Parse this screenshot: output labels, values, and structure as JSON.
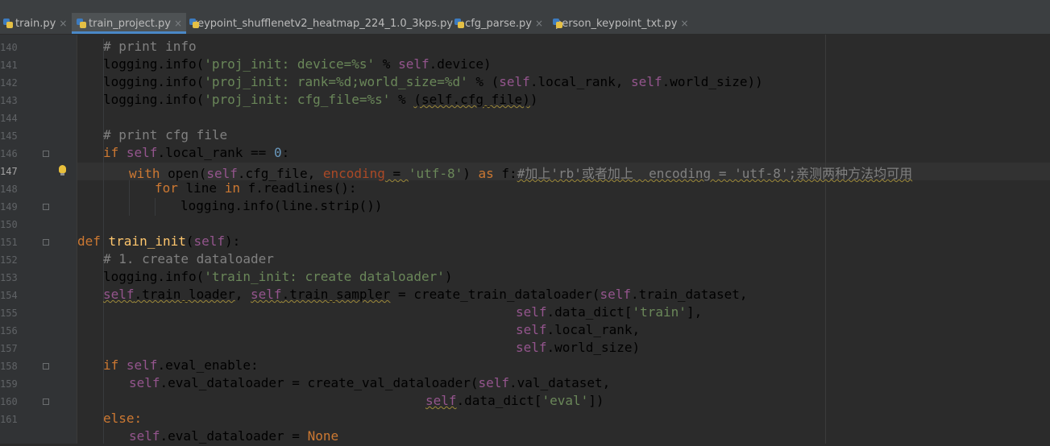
{
  "tabs": [
    {
      "label": "train.py",
      "active": false
    },
    {
      "label": "train_project.py",
      "active": true
    },
    {
      "label": "keypoint_shufflenetv2_heatmap_224_1.0_3kps.py",
      "active": false
    },
    {
      "label": "cfg_parse.py",
      "active": false
    },
    {
      "label": "person_keypoint_txt.py",
      "active": false
    }
  ],
  "gutter": {
    "line_numbers": [
      "140",
      "141",
      "142",
      "143",
      "144",
      "145",
      "146",
      "147",
      "148",
      "149",
      "150",
      "151",
      "152",
      "153",
      "154",
      "155",
      "156",
      "157",
      "158",
      "159",
      "160",
      "161"
    ]
  },
  "code": {
    "l140": {
      "a": "# print info"
    },
    "l141": {
      "a": "logging.info(",
      "b": "'proj_init: device=%s'",
      "c": " % ",
      "d": "self",
      "e": ".device)"
    },
    "l142": {
      "a": "logging.info(",
      "b": "'proj_init: rank=%d;world_size=%d'",
      "c": " % (",
      "d": "self",
      "e": ".local_rank, ",
      "f": "self",
      "g": ".world_size))"
    },
    "l143": {
      "a": "logging.info(",
      "b": "'proj_init: cfg_file=%s'",
      "c": " % ",
      "d": "(self.cfg_file)",
      "e": ")"
    },
    "l145": {
      "a": "# print cfg file"
    },
    "l146": {
      "a": "if ",
      "b": "self",
      "c": ".local_rank == ",
      "d": "0",
      "e": ":"
    },
    "l147": {
      "a": "with ",
      "b": "open(",
      "c": "self",
      "d": ".cfg_file, ",
      "e": "encoding",
      "f": " = ",
      "g": "'utf-8'",
      "h": ") ",
      "i": "as ",
      "j": "f:",
      "k": "#加上'rb'或者加上  encoding = 'utf-8';亲测两种方法均可用"
    },
    "l148": {
      "a": "for ",
      "b": "line ",
      "c": "in ",
      "d": "f.readlines():"
    },
    "l149": {
      "a": "logging.info(line.strip())"
    },
    "l151": {
      "a": "def ",
      "b": "train_init",
      "c": "(",
      "d": "self",
      "e": "):"
    },
    "l152": {
      "a": "# 1. create dataloader"
    },
    "l153": {
      "a": "logging.info(",
      "b": "'train_init: create dataloader'",
      "c": ")"
    },
    "l154": {
      "a": "self",
      "b": ".train_loader",
      "c": ", ",
      "d": "self",
      "e": ".train_sampler",
      "f": " = create_train_dataloader(",
      "g": "self",
      "h": ".train_dataset,"
    },
    "l155": {
      "a": "self",
      "b": ".data_dict[",
      "c": "'train'",
      "d": "],"
    },
    "l156": {
      "a": "self",
      "b": ".local_rank,"
    },
    "l157": {
      "a": "self",
      "b": ".world_size)"
    },
    "l158": {
      "a": "if ",
      "b": "self",
      "c": ".eval_enable:"
    },
    "l159": {
      "a": "self",
      "b": ".eval_dataloader = create_val_dataloader(",
      "c": "self",
      "d": ".val_dataset,"
    },
    "l160": {
      "a": "self",
      "b": ".data_dict[",
      "c": "'eval'",
      "d": "])"
    },
    "l161": {
      "a": "else:"
    },
    "l162": {
      "a": "self",
      "b": ".eval_dataloader = ",
      "c": "None"
    }
  }
}
